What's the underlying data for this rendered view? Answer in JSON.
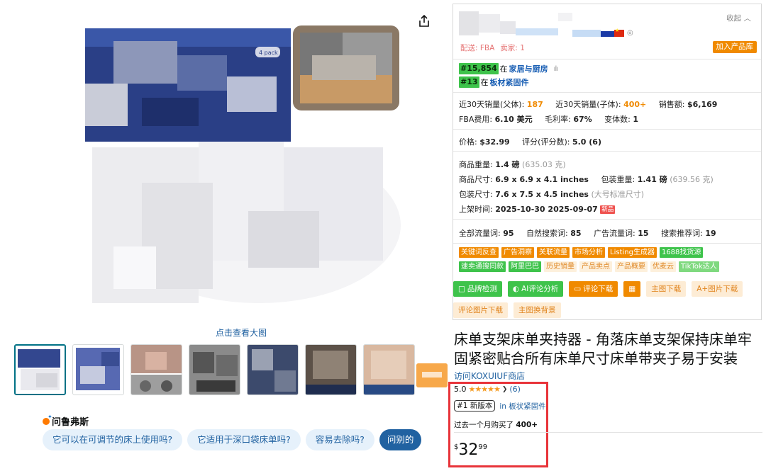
{
  "share_icon": "share-icon",
  "view_large": "点击查看大图",
  "thumbnails": [
    "thumb-1",
    "thumb-2",
    "thumb-3",
    "thumb-4",
    "thumb-5",
    "thumb-6",
    "thumb-7"
  ],
  "rufus": {
    "title": "问鲁弗斯",
    "questions": [
      "它可以在可调节的床上使用吗?",
      "它适用于深口袋床单吗?",
      "容易去除吗?"
    ],
    "more": "问别的"
  },
  "panel": {
    "collect": "收起",
    "shipping": "配送:  FBA",
    "sellers": "卖家: 1",
    "add_library": "加入产品库",
    "rank1": {
      "badge": "#15,854",
      "in": "在",
      "category": "家居与厨房"
    },
    "rank2": {
      "badge": "#13",
      "in": "在",
      "category": "板材紧固件"
    },
    "sales_parent_label": "近30天销量(父体):",
    "sales_parent": "187",
    "sales_child_label": "近30天销量(子体):",
    "sales_child": "400+",
    "revenue_label": "销售额:",
    "revenue": "$6,169",
    "fba_label": "FBA费用:",
    "fba": "6.10 美元",
    "margin_label": "毛利率:",
    "margin": "67%",
    "variants_label": "变体数:",
    "variants": "1",
    "price_label": "价格:",
    "price": "$32.99",
    "score_label": "评分(评分数):",
    "score": "5.0  (6)",
    "weight_label": "商品重量:",
    "weight": "1.4 磅",
    "weight_g": "(635.03 克)",
    "size_label": "商品尺寸:",
    "size": "6.9 x 6.9 x 4.1 inches",
    "pkg_weight_label": "包装重量:",
    "pkg_weight": "1.41 磅",
    "pkg_weight_g": "(639.56 克)",
    "pkg_size_label": "包装尺寸:",
    "pkg_size": "7.6 x 7.5 x 4.5 inches",
    "pkg_size_note": "(大号标准尺寸)",
    "listed_label": "上架时间:",
    "listed": "2025-10-30 2025-09-07",
    "new_tag": "新品",
    "kw_all_label": "全部流量词:",
    "kw_all": "95",
    "kw_organic_label": "自然搜索词:",
    "kw_organic": "85",
    "kw_ad_label": "广告流量词:",
    "kw_ad": "15",
    "kw_rec_label": "搜索推荐词:",
    "kw_rec": "19",
    "tags_row1": [
      {
        "label": "关键词反查",
        "style": "o"
      },
      {
        "label": "广告洞察",
        "style": "o"
      },
      {
        "label": "关联流量",
        "style": "o"
      },
      {
        "label": "市场分析",
        "style": "o"
      },
      {
        "label": "Listing生成器",
        "style": "o"
      },
      {
        "label": "1688找货源",
        "style": "g"
      }
    ],
    "tags_row2": [
      {
        "label": "速卖通搜同款",
        "style": "g"
      },
      {
        "label": "阿里巴巴",
        "style": "g"
      },
      {
        "label": "历史销量",
        "style": "og"
      },
      {
        "label": "产品卖点",
        "style": "og"
      },
      {
        "label": "产品概要",
        "style": "og"
      },
      {
        "label": "优麦云",
        "style": "og"
      },
      {
        "label": "TikTok达人",
        "style": "gg"
      }
    ]
  },
  "buttons_row1": [
    {
      "label": "品牌检测",
      "style": "green",
      "icon": "□"
    },
    {
      "label": "AI评论分析",
      "style": "green",
      "icon": "◐"
    },
    {
      "label": "评论下载",
      "style": "orange",
      "icon": "▭"
    },
    {
      "label": "",
      "style": "orange",
      "icon": "▦"
    },
    {
      "label": "主图下载",
      "style": "light",
      "icon": ""
    },
    {
      "label": "A+图片下载",
      "style": "light",
      "icon": ""
    }
  ],
  "buttons_row2": [
    {
      "label": "评论图片下载",
      "style": "light",
      "icon": ""
    },
    {
      "label": "主图换背景",
      "style": "light",
      "icon": ""
    }
  ],
  "product": {
    "title": "床单支架床单夹持器 - 角落床单支架保持床单牢固紧密贴合所有床单尺寸床单带夹子易于安装",
    "store": "访问KOXUIUF商店",
    "rating": "5.0",
    "stars": "★★★★★",
    "rating_count": "(6)",
    "best_badge": "#1 新版本",
    "best_in": "in 板状紧固件",
    "bought_prefix": "过去一个月购买了",
    "bought_count": "400+",
    "price_currency": "$",
    "price_whole": "32",
    "price_fraction": "99"
  }
}
